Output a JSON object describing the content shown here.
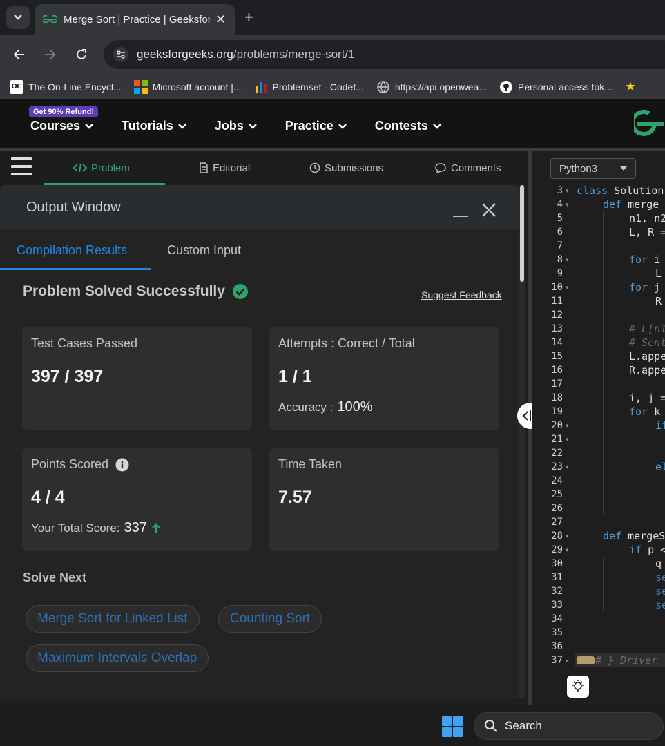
{
  "browser": {
    "tab_title": "Merge Sort | Practice | GeeksforGeeks",
    "close_glyph": "✕",
    "new_tab_glyph": "+",
    "url_host": "geeksforgeeks.org",
    "url_path": "/problems/merge-sort/1",
    "bookmarks": [
      {
        "label": "The On-Line Encycl...",
        "icon": "oeis-icon",
        "color": "#ffffff"
      },
      {
        "label": "Microsoft account |...",
        "icon": "microsoft-icon",
        "color": "#f35325"
      },
      {
        "label": "Problemset - Codef...",
        "icon": "codeforces-icon",
        "color": "#1f8acb"
      },
      {
        "label": "https://api.openwea...",
        "icon": "globe-icon",
        "color": "#9aa0a6"
      },
      {
        "label": "Personal access tok...",
        "icon": "github-icon",
        "color": "#ffffff"
      }
    ]
  },
  "header": {
    "refund_badge": "Get 90% Refund!",
    "nav": [
      "Courses",
      "Tutorials",
      "Jobs",
      "Practice",
      "Contests"
    ]
  },
  "problem_tabs": {
    "problem": "Problem",
    "editorial": "Editorial",
    "submissions": "Submissions",
    "comments": "Comments"
  },
  "output_window": {
    "title": "Output Window",
    "tabs": [
      "Compilation Results",
      "Custom Input"
    ],
    "status": "Problem Solved Successfully",
    "suggest_feedback": "Suggest Feedback",
    "cards": {
      "test_cases_label": "Test Cases Passed",
      "test_cases_value": "397 / 397",
      "attempts_label": "Attempts : Correct / Total",
      "attempts_value": "1 / 1",
      "accuracy_label": "Accuracy :",
      "accuracy_value": "100%",
      "points_label": "Points Scored",
      "points_value": "4 / 4",
      "total_score_label": "Your Total Score:",
      "total_score_value": "337",
      "time_label": "Time Taken",
      "time_value": "7.57"
    },
    "solve_next_label": "Solve Next",
    "solve_next": [
      "Merge Sort for Linked List",
      "Counting Sort",
      "Maximum Intervals Overlap"
    ]
  },
  "editor": {
    "language": "Python3",
    "line_numbers": [
      "3",
      "4",
      "5",
      "6",
      "7",
      "8",
      "9",
      "10",
      "11",
      "12",
      "13",
      "14",
      "15",
      "16",
      "17",
      "18",
      "19",
      "20",
      "21",
      "22",
      "23",
      "24",
      "25",
      "26",
      "27",
      "28",
      "29",
      "30",
      "31",
      "32",
      "33",
      "34",
      "35",
      "36",
      "37"
    ],
    "code": {
      "l3_kw": "class",
      "l3_rest": " Solution",
      "l4_kw": "def",
      "l4_rest": " merge",
      "l5": "n1, n2",
      "l6": "L, R =",
      "l8_kw": "for",
      "l8_rest": " i",
      "l9": "L",
      "l10_kw": "for",
      "l10_rest": " j",
      "l11": "R",
      "l13": "# L[n1",
      "l14": "# Sent",
      "l15": "L.appe",
      "l16": "R.appe",
      "l18": "i, j =",
      "l19_kw": "for",
      "l19_rest": " k",
      "l20": "if",
      "l23": "el",
      "l28_kw": "def",
      "l28_rest": " mergeS",
      "l29_kw": "if",
      "l29_rest": " p <",
      "l30": "q",
      "l31": "se",
      "l32": "se",
      "l33": "se",
      "l37": "# } Driver"
    }
  },
  "taskbar": {
    "search": "Search"
  },
  "colors": {
    "accent_green": "#2ea46b",
    "accent_blue": "#1e88e5",
    "link_blue": "#2d6fb3"
  }
}
